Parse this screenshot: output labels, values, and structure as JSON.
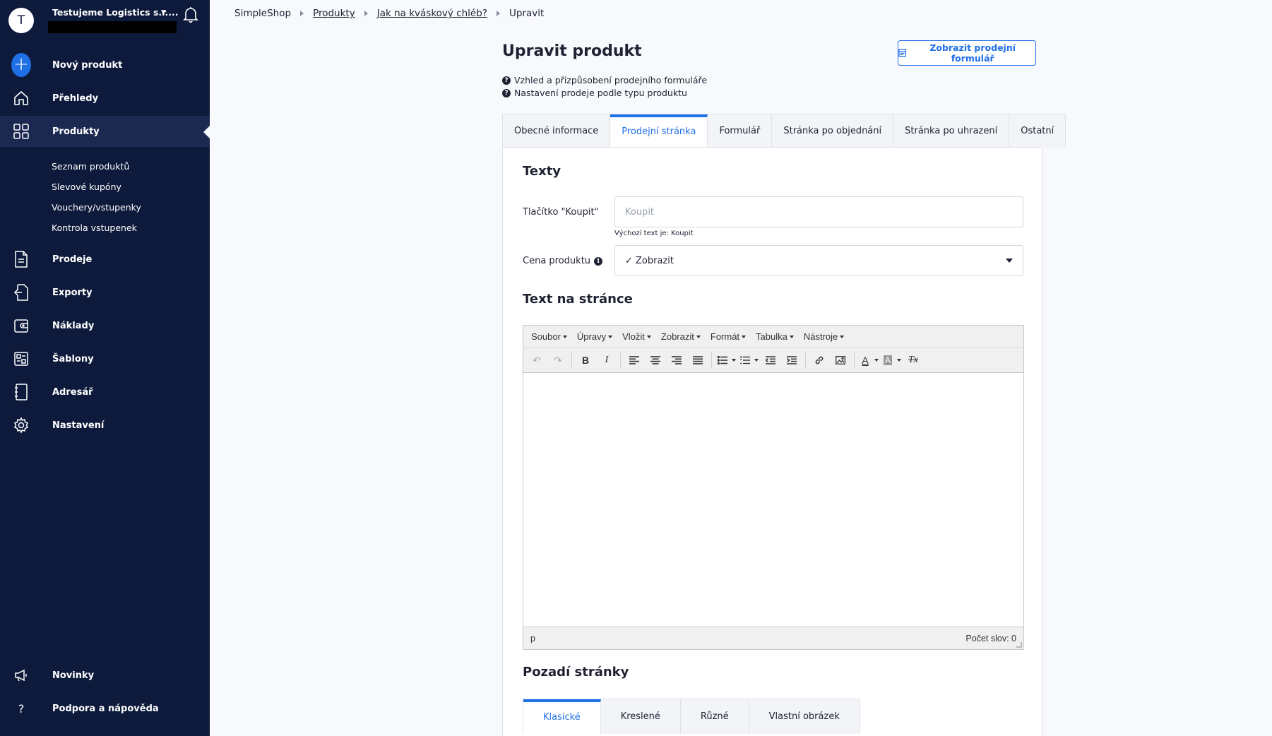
{
  "account": {
    "initial": "T",
    "name": "Testujeme Logistics s.r...."
  },
  "sidebar": {
    "items": [
      {
        "label": "Nový produkt",
        "icon": "plus-icon"
      },
      {
        "label": "Přehledy",
        "icon": "home-icon"
      },
      {
        "label": "Produkty",
        "icon": "grid-icon",
        "active": true
      },
      {
        "label": "Prodeje",
        "icon": "document-icon"
      },
      {
        "label": "Exporty",
        "icon": "export-icon"
      },
      {
        "label": "Náklady",
        "icon": "wallet-icon"
      },
      {
        "label": "Šablony",
        "icon": "templates-icon"
      },
      {
        "label": "Adresář",
        "icon": "address-book-icon"
      },
      {
        "label": "Nastavení",
        "icon": "gear-icon"
      }
    ],
    "sub_items": [
      "Seznam produktů",
      "Slevové kupóny",
      "Vouchery/vstupenky",
      "Kontrola vstupenek"
    ],
    "bottom_items": [
      {
        "label": "Novinky",
        "icon": "megaphone-icon"
      },
      {
        "label": "Podpora a nápověda",
        "icon": "question-icon"
      }
    ]
  },
  "breadcrumb": [
    "SimpleShop",
    "Produkty",
    "Jak na kváskový chléb?",
    "Upravit"
  ],
  "header": {
    "title": "Upravit produkt",
    "preview_button": "Zobrazit prodejní formulář",
    "help_links": [
      "Vzhled a přizpůsobení prodejního formuláře",
      "Nastavení prodeje podle typu produktu"
    ]
  },
  "tabs": [
    {
      "label": "Obecné informace"
    },
    {
      "label": "Prodejní stránka",
      "active": true
    },
    {
      "label": "Formulář"
    },
    {
      "label": "Stránka po objednání"
    },
    {
      "label": "Stránka po uhrazení"
    },
    {
      "label": "Ostatní"
    }
  ],
  "texts_section": {
    "title": "Texty",
    "buy_label": "Tlačítko \"Koupit\"",
    "buy_placeholder": "Koupit",
    "buy_hint": "Výchozí text je: Koupit",
    "price_label": "Cena produktu",
    "price_value": "✓ Zobrazit"
  },
  "page_text_section": {
    "title": "Text na stránce",
    "menu": [
      "Soubor",
      "Úpravy",
      "Vložit",
      "Zobrazit",
      "Formát",
      "Tabulka",
      "Nástroje"
    ],
    "path": "p",
    "word_count": "Počet slov: 0"
  },
  "background_section": {
    "title": "Pozadí stránky",
    "tabs": [
      {
        "label": "Klasické",
        "active": true
      },
      {
        "label": "Kreslené"
      },
      {
        "label": "Různé"
      },
      {
        "label": "Vlastní obrázek"
      }
    ]
  },
  "colors": {
    "sidebar_bg": "#0d1a3b",
    "accent": "#1f6fe5"
  }
}
